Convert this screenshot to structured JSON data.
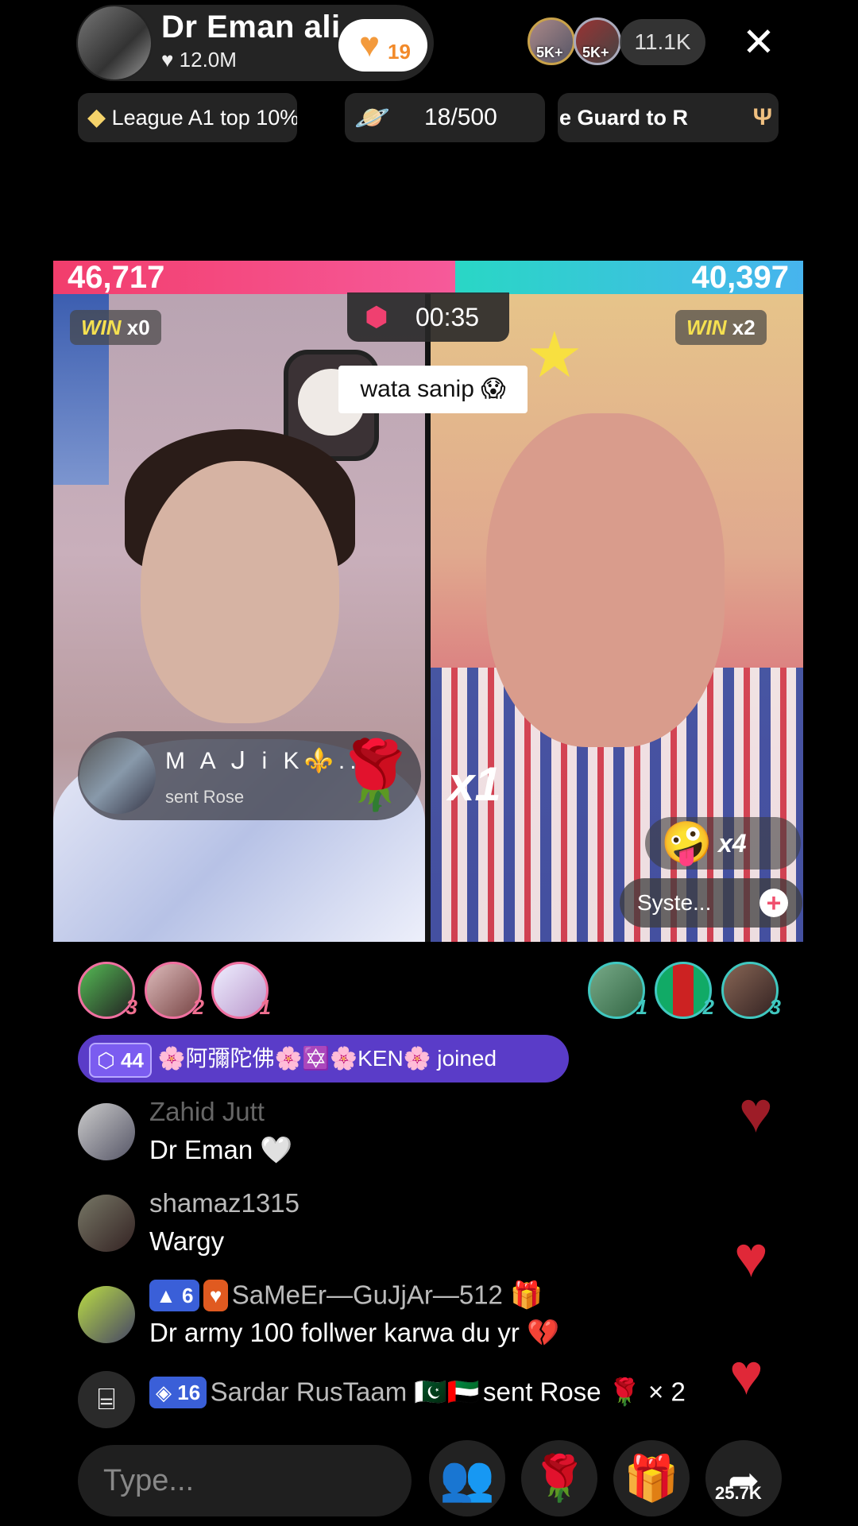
{
  "header": {
    "host_name": "Dr Eman ali",
    "host_likes": "♥ 12.0M",
    "heart_badge_num": "19",
    "viewer_badge_1": "5K+",
    "viewer_badge_2": "5K+",
    "viewer_count": "11.1K",
    "close_icon": "✕"
  },
  "chips": {
    "league": "League A1 top 10%",
    "progress": "18/500",
    "guard": "e   Guard to R"
  },
  "battle": {
    "score_left": "46,717",
    "score_right": "40,397",
    "left_fraction": 0.536,
    "win_left_label": "WIN",
    "win_left_count": "x0",
    "win_right_label": "WIN",
    "win_right_count": "x2",
    "timer": "00:35",
    "caption": "wata sanip 😱",
    "multiplier": "x1",
    "combo_count": "x4",
    "system_label": "Syste...",
    "gift_user": "M A ᒍ i K⚜️...",
    "gift_sub": "sent Rose"
  },
  "top_left_ranks": [
    "3",
    "2",
    "1"
  ],
  "top_right_ranks": [
    "1",
    "2",
    "3"
  ],
  "chat": {
    "joined_level": "44",
    "joined_text": "🌸阿彌陀佛🌸✡️🌸KEN🌸 joined",
    "messages": [
      {
        "user": "Zahid Jutt",
        "text": "Dr Eman 🤍"
      },
      {
        "user": "shamaz1315",
        "text": "Wargy"
      },
      {
        "level": "6",
        "user": "SaMeEr—GuJjAr—512 🎁",
        "text": "Dr army 100 follwer karwa du yr 💔"
      }
    ],
    "gift_level": "16",
    "gift_user": "Sardar RusTaam 🇵🇰🇦🇪",
    "gift_text": "sent Rose 🌹 × 2"
  },
  "bottom": {
    "input_placeholder": "Type...",
    "share_count": "25.7K"
  },
  "colors": {
    "left_team": "#f23d6c",
    "right_team": "#29d7c5",
    "heart": "#e02838",
    "joined_bg": "#5a3cc8"
  }
}
